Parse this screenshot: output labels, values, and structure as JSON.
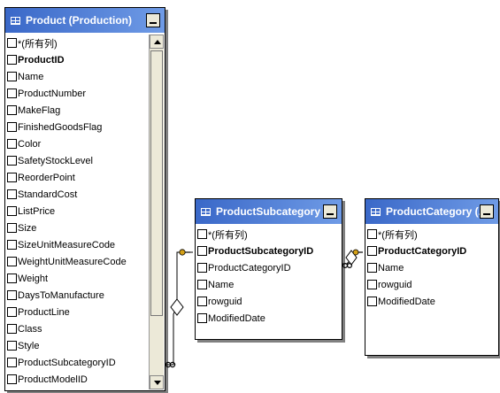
{
  "tables": {
    "product": {
      "title": "Product (Production)",
      "rows": [
        {
          "label": "*(所有列)",
          "key": false
        },
        {
          "label": "ProductID",
          "key": true
        },
        {
          "label": "Name",
          "key": false
        },
        {
          "label": "ProductNumber",
          "key": false
        },
        {
          "label": "MakeFlag",
          "key": false
        },
        {
          "label": "FinishedGoodsFlag",
          "key": false
        },
        {
          "label": "Color",
          "key": false
        },
        {
          "label": "SafetyStockLevel",
          "key": false
        },
        {
          "label": "ReorderPoint",
          "key": false
        },
        {
          "label": "StandardCost",
          "key": false
        },
        {
          "label": "ListPrice",
          "key": false
        },
        {
          "label": "Size",
          "key": false
        },
        {
          "label": "SizeUnitMeasureCode",
          "key": false
        },
        {
          "label": "WeightUnitMeasureCode",
          "key": false
        },
        {
          "label": "Weight",
          "key": false
        },
        {
          "label": "DaysToManufacture",
          "key": false
        },
        {
          "label": "ProductLine",
          "key": false
        },
        {
          "label": "Class",
          "key": false
        },
        {
          "label": "Style",
          "key": false
        },
        {
          "label": "ProductSubcategoryID",
          "key": false
        },
        {
          "label": "ProductModelID",
          "key": false
        }
      ]
    },
    "subcategory": {
      "title": "ProductSubcategory ...",
      "rows": [
        {
          "label": "*(所有列)",
          "key": false
        },
        {
          "label": "ProductSubcategoryID",
          "key": true
        },
        {
          "label": "ProductCategoryID",
          "key": false
        },
        {
          "label": "Name",
          "key": false
        },
        {
          "label": "rowguid",
          "key": false
        },
        {
          "label": "ModifiedDate",
          "key": false
        }
      ]
    },
    "category": {
      "title": "ProductCategory (...",
      "rows": [
        {
          "label": "*(所有列)",
          "key": false
        },
        {
          "label": "ProductCategoryID",
          "key": true
        },
        {
          "label": "Name",
          "key": false
        },
        {
          "label": "rowguid",
          "key": false
        },
        {
          "label": "ModifiedDate",
          "key": false
        }
      ]
    }
  },
  "colors": {
    "header": "#3a68c8",
    "key_icon": "#d4a017"
  }
}
